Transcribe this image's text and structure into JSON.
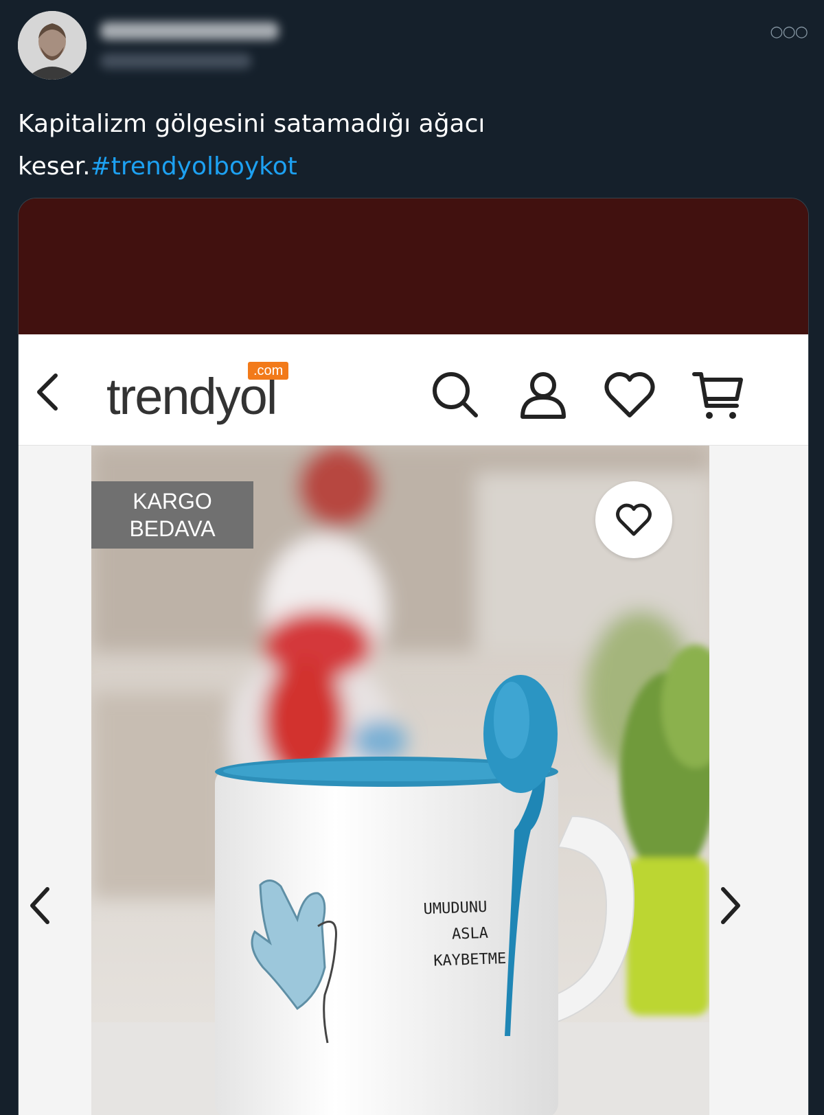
{
  "tweet": {
    "text": "Kapitalizm gölgesini satamadığı ağacı keser.",
    "hashtag": "#trendyolboykot",
    "more_icon": "more-horizontal-icon"
  },
  "app": {
    "logo_text": "trendyol",
    "logo_badge": ".com",
    "brand_color": "#f27a1a",
    "icons": [
      "back-chevron-icon",
      "search-icon",
      "user-icon",
      "heart-icon",
      "cart-icon"
    ]
  },
  "product": {
    "badge_line1": "KARGO",
    "badge_line2": "BEDAVA",
    "mug_text": [
      "UMUDUNU",
      "ASLA",
      "KAYBETME"
    ]
  }
}
